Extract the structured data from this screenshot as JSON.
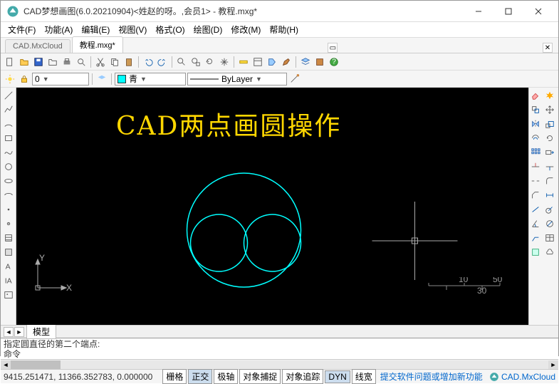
{
  "window": {
    "title": "CAD梦想画图(6.0.20210904)<姓赵的呀。,会员1> - 教程.mxg*"
  },
  "menu": {
    "file": "文件(F)",
    "func": "功能(A)",
    "edit": "编辑(E)",
    "view": "视图(V)",
    "format": "格式(O)",
    "draw": "绘图(D)",
    "modify": "修改(M)",
    "help": "帮助(H)"
  },
  "tabs": {
    "cloud": "CAD.MxCloud",
    "active": "教程.mxg*"
  },
  "props": {
    "layer0": "0",
    "color_label": "青",
    "linetype": "ByLayer"
  },
  "canvas": {
    "headline": "CAD两点画圆操作",
    "scale_10": "10",
    "scale_30": "30",
    "scale_50": "50",
    "axis_y": "Y",
    "axis_x": "X"
  },
  "layout": {
    "model": "模型"
  },
  "cmd": {
    "prompt": "指定圆直径的第二个端点:",
    "label": "命令"
  },
  "status": {
    "coords": "9415.251471, 11366.352783, 0.000000",
    "grid": "栅格",
    "ortho": "正交",
    "polar": "极轴",
    "osnap": "对象捕捉",
    "otrack": "对象追踪",
    "dyn": "DYN",
    "lwt": "线宽",
    "feedback": "提交软件问题或增加新功能",
    "brand": "CAD.MxCloud"
  }
}
